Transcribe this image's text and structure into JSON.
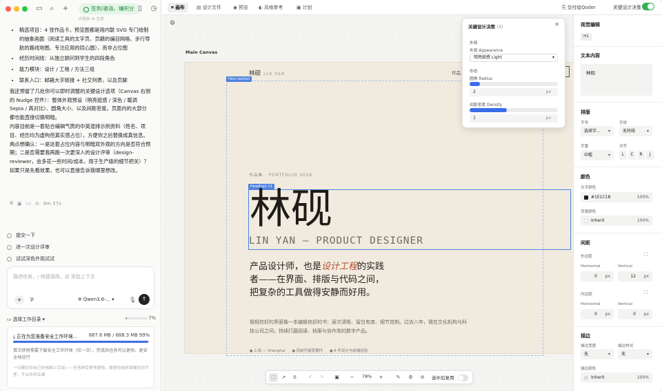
{
  "sidebar": {
    "pill": "签到/邀请，赚积分",
    "pill_hint": "内容由 AI 生成",
    "chat_bullets": [
      "精选项目：4 张作品卡，预览图都是用内联 SVG 专门绘制的抽象画面（阅读工具的文字页、页籍的编目网格、步行导航的路线地图、专注应用的同心圆），而非占位图",
      "经历时间线：从独立顾问到学生的四段角色",
      "能力模块：设计 / 工程 / 方法三组",
      "联系入口：邮箱大字链接 + 社交列表，以及页脚"
    ],
    "chat_para1": "我还预留了几处你可以即时调整的关键设计选项（Canvas 右侧的 Nudge 控件）：整体外观预设（明亮纸感 / 深色 / 暖调 Sepia / 高对比）、圆角大小、以及间距密度。页面内的大部分都也能直接切换明暗。",
    "chat_para2": "内容目前是一套贴合编辑气质的中英混排示例资料（姓名、项目、经历均为虚构但真实感占位），方便你之后替换成真信息。",
    "chat_para3": "两点想确认：一是这套占位内容与明暗双外观的方向是否符合预期；二是否需要我再跑一次更深入的设计评审（design-reviewer，会多花一些时间/成本，用于生产级的细节把关）？如果只是先看效果，也可以直接告诉我哪里想改。",
    "msg_time": "8m 57s",
    "suggestions": [
      "提交一下",
      "进一次设计评审",
      "试试深色外观试试"
    ],
    "input_placeholder": "描述任务，/ 快捷调用，@ 添加上下文",
    "model_label": "Qwen3.6-...",
    "dir_label": "选择工作目录",
    "dir_percent": "7%",
    "dir_progress": 0.07,
    "env_text": "正在为您准备安全工作环境...",
    "env_size": "687.6 MB / 688.3 MB 99%",
    "env_progress": 0.99,
    "env_desc": "首次使用需要下载安全工作环境（仅一次），完成后任务可以更快、更安全地运行",
    "env_desc2": "一切都在你自己的电脑上完成——任务跨受更快更稳，数据也始终掌握在你手里，不会传到云端"
  },
  "topbar": {
    "tabs": [
      "画布",
      "设计文件",
      "预览",
      "风格参考",
      "计划"
    ],
    "handoff": "交付给Qoder",
    "decisions_label": "关键设计决策"
  },
  "canvas": {
    "label": "Main Canvas",
    "logo": "林砚",
    "logo_en": "LIN YAN",
    "nav_hint": "作品",
    "tag_hero": "Hero section",
    "tag_heading": "Heading1 h1",
    "kicker": "作品集 · PORTFOLIO 2026",
    "name": "林砚",
    "subname": "LIN YAN — PRODUCT DESIGNER",
    "lead_a": "产品设计师，也是",
    "lead_em": "设计工程",
    "lead_b": "的实践者——在界面、排版与代码之间，把复杂的工具做得安静而好用。",
    "desc": "我相信好的界面像一本编辑良好的书：层次清晰、留白有度、细节克制。过去八年，我在文化机构与科技公司之间，持续打磨阅读、档案与协作类的数字产品。",
    "meta": [
      "上海 — Shanghai",
      "目前可接受委托",
      "8 年设计与前端经验"
    ]
  },
  "popover": {
    "title": "关键设计决策",
    "count": "(3)",
    "group": "外观",
    "appearance_label": "外观 Appearance",
    "appearance_value": "明亮纸感 Light",
    "shape_group": "形态",
    "radius_label": "圆角 Radius",
    "radius_value": "2",
    "radius_unit": "px",
    "radius_fraction": 0.12,
    "density_label": "间距密度 Density",
    "density_value": "1",
    "density_fraction": 0.42
  },
  "inspector": {
    "title": "视觉编辑",
    "badge": "H1",
    "text_section": "文本内容",
    "text_value": "林砚",
    "type_section": "排版",
    "font_size_label": "字号",
    "font_size_value": "选择字...",
    "font_weight_label": "字体",
    "font_weight_value": "无衬线",
    "line_height_label": "字重",
    "line_height_value": "中粗",
    "align_label": "对齐",
    "align_opts": [
      "L",
      "C",
      "R",
      "J"
    ],
    "color_section": "颜色",
    "text_color_label": "文字颜色",
    "text_color_value": "#1E1C18",
    "text_color_pct": "100%",
    "text_color_hex": "#1e1c18",
    "bg_color_label": "背景颜色",
    "bg_color_value": "Inherit",
    "bg_color_pct": "100%",
    "spacing_section": "间距",
    "margin_label": "外边距",
    "horizontal_label": "Horizontal",
    "vertical_label": "Vertical",
    "margin_h": "0",
    "margin_v": "12",
    "padding_label": "内边距",
    "padding_h": "0",
    "padding_v": "0",
    "unit": "px",
    "border_section": "描边",
    "border_width_label": "描边宽度",
    "border_style_label": "描边样式",
    "border_width_value": "无",
    "border_style_value": "无",
    "border_color_label": "描边颜色",
    "border_color_value": "Inherit",
    "border_color_pct": "100%"
  },
  "toolbar": {
    "zoom": "78%",
    "select_label": "选中后复用"
  }
}
